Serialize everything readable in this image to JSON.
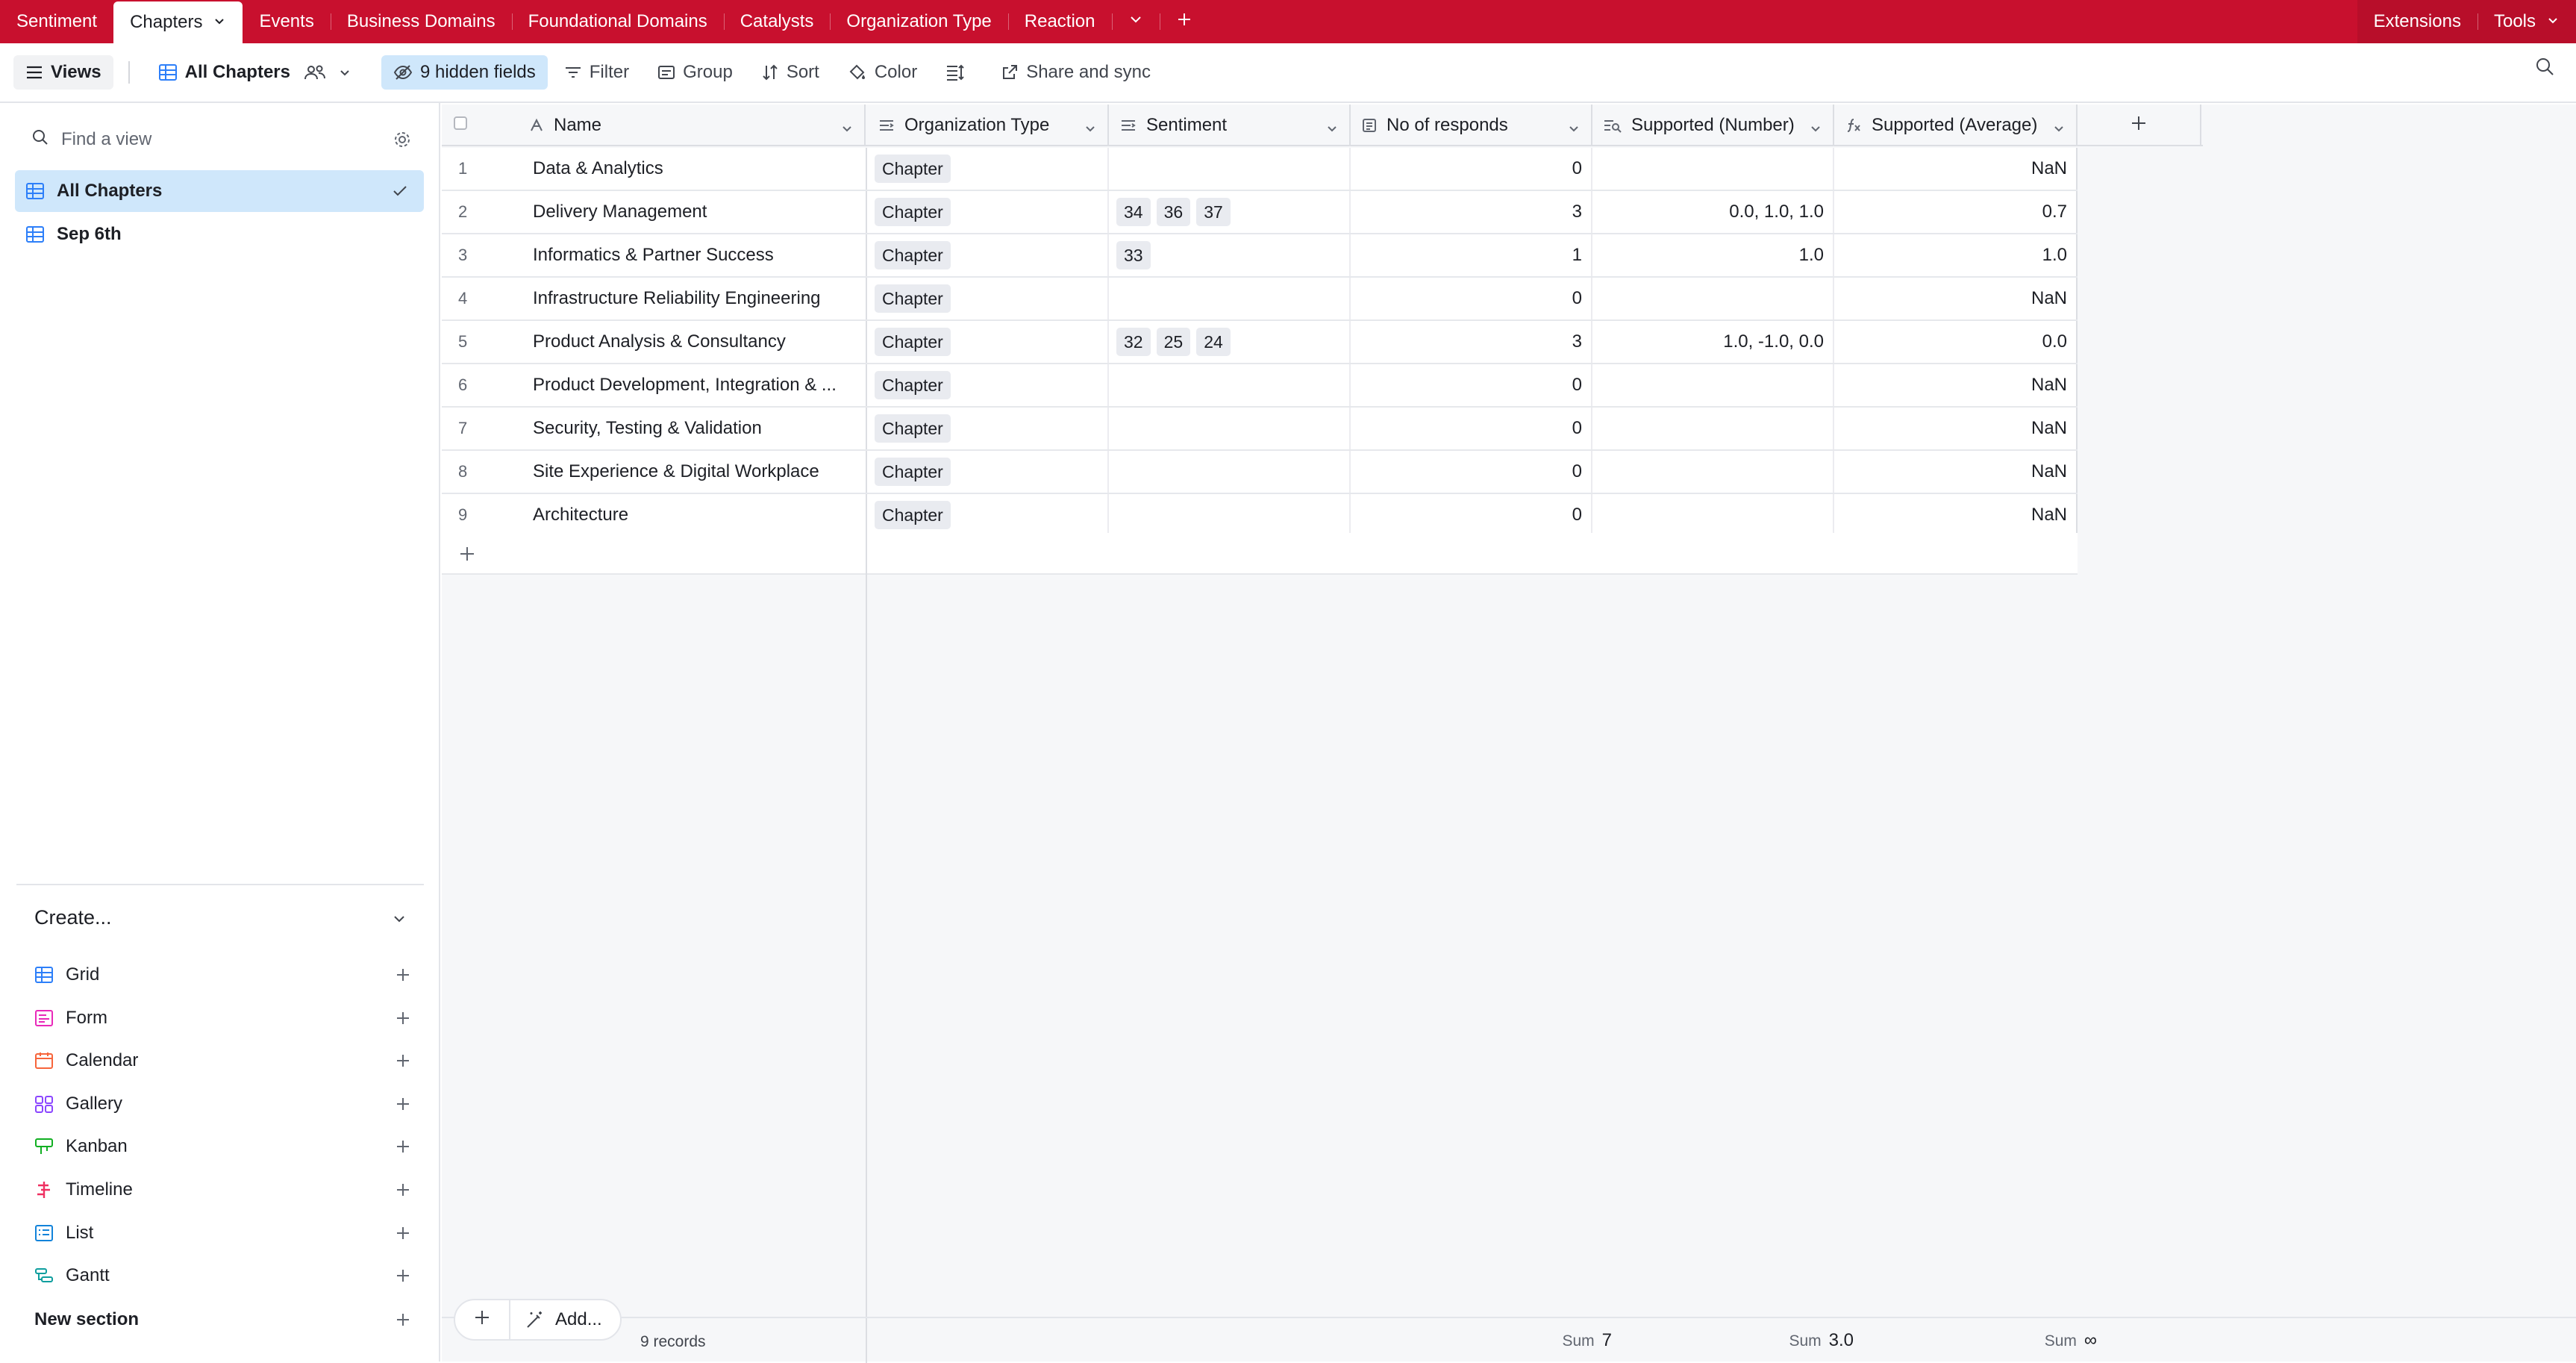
{
  "tabs": [
    {
      "label": "Sentiment",
      "active": false
    },
    {
      "label": "Chapters",
      "active": true
    },
    {
      "label": "Events",
      "active": false
    },
    {
      "label": "Business Domains",
      "active": false
    },
    {
      "label": "Foundational Domains",
      "active": false
    },
    {
      "label": "Catalysts",
      "active": false
    },
    {
      "label": "Organization Type",
      "active": false
    },
    {
      "label": "Reaction",
      "active": false
    }
  ],
  "top_right": {
    "extensions": "Extensions",
    "tools": "Tools"
  },
  "toolbar": {
    "views": "Views",
    "current_view": "All Chapters",
    "hidden_fields": "9 hidden fields",
    "filter": "Filter",
    "group": "Group",
    "sort": "Sort",
    "color": "Color",
    "share": "Share and sync"
  },
  "sidebar": {
    "search_placeholder": "Find a view",
    "views": [
      {
        "label": "All Chapters",
        "selected": true
      },
      {
        "label": "Sep 6th",
        "selected": false
      }
    ],
    "create_title": "Create...",
    "create_items": [
      {
        "label": "Grid",
        "icon": "grid-icon",
        "color": "#2d7ff9"
      },
      {
        "label": "Form",
        "icon": "form-icon",
        "color": "#e929ba"
      },
      {
        "label": "Calendar",
        "icon": "calendar-icon",
        "color": "#f7653b"
      },
      {
        "label": "Gallery",
        "icon": "gallery-icon",
        "color": "#8b46ff"
      },
      {
        "label": "Kanban",
        "icon": "kanban-icon",
        "color": "#11af22"
      },
      {
        "label": "Timeline",
        "icon": "timeline-icon",
        "color": "#ef3061"
      },
      {
        "label": "List",
        "icon": "list-icon",
        "color": "#1283da"
      },
      {
        "label": "Gantt",
        "icon": "gantt-icon",
        "color": "#0f9e9e"
      }
    ],
    "new_section": "New section"
  },
  "columns": {
    "name": "Name",
    "org_type": "Organization Type",
    "sentiment": "Sentiment",
    "responds": "No of responds",
    "supported_number": "Supported (Number)",
    "supported_average": "Supported (Average)"
  },
  "rows": [
    {
      "n": "1",
      "name": "Data & Analytics",
      "org": "Chapter",
      "sentiment": [],
      "responds": "0",
      "supp_num": "",
      "supp_avg": "NaN"
    },
    {
      "n": "2",
      "name": "Delivery Management",
      "org": "Chapter",
      "sentiment": [
        "34",
        "36",
        "37"
      ],
      "responds": "3",
      "supp_num": "0.0, 1.0, 1.0",
      "supp_avg": "0.7"
    },
    {
      "n": "3",
      "name": "Informatics & Partner Success",
      "org": "Chapter",
      "sentiment": [
        "33"
      ],
      "responds": "1",
      "supp_num": "1.0",
      "supp_avg": "1.0"
    },
    {
      "n": "4",
      "name": "Infrastructure Reliability Engineering",
      "org": "Chapter",
      "sentiment": [],
      "responds": "0",
      "supp_num": "",
      "supp_avg": "NaN"
    },
    {
      "n": "5",
      "name": "Product Analysis & Consultancy",
      "org": "Chapter",
      "sentiment": [
        "32",
        "25",
        "24"
      ],
      "responds": "3",
      "supp_num": "1.0, -1.0, 0.0",
      "supp_avg": "0.0"
    },
    {
      "n": "6",
      "name": "Product Development, Integration & ...",
      "org": "Chapter",
      "sentiment": [],
      "responds": "0",
      "supp_num": "",
      "supp_avg": "NaN"
    },
    {
      "n": "7",
      "name": "Security, Testing & Validation",
      "org": "Chapter",
      "sentiment": [],
      "responds": "0",
      "supp_num": "",
      "supp_avg": "NaN"
    },
    {
      "n": "8",
      "name": "Site Experience & Digital Workplace",
      "org": "Chapter",
      "sentiment": [],
      "responds": "0",
      "supp_num": "",
      "supp_avg": "NaN"
    },
    {
      "n": "9",
      "name": "Architecture",
      "org": "Chapter",
      "sentiment": [],
      "responds": "0",
      "supp_num": "",
      "supp_avg": "NaN"
    }
  ],
  "footer": {
    "add_label": "Add...",
    "records": "9 records",
    "sum_label": "Sum",
    "sum_responds": "7",
    "sum_supported_number": "3.0",
    "sum_supported_average": "∞"
  }
}
